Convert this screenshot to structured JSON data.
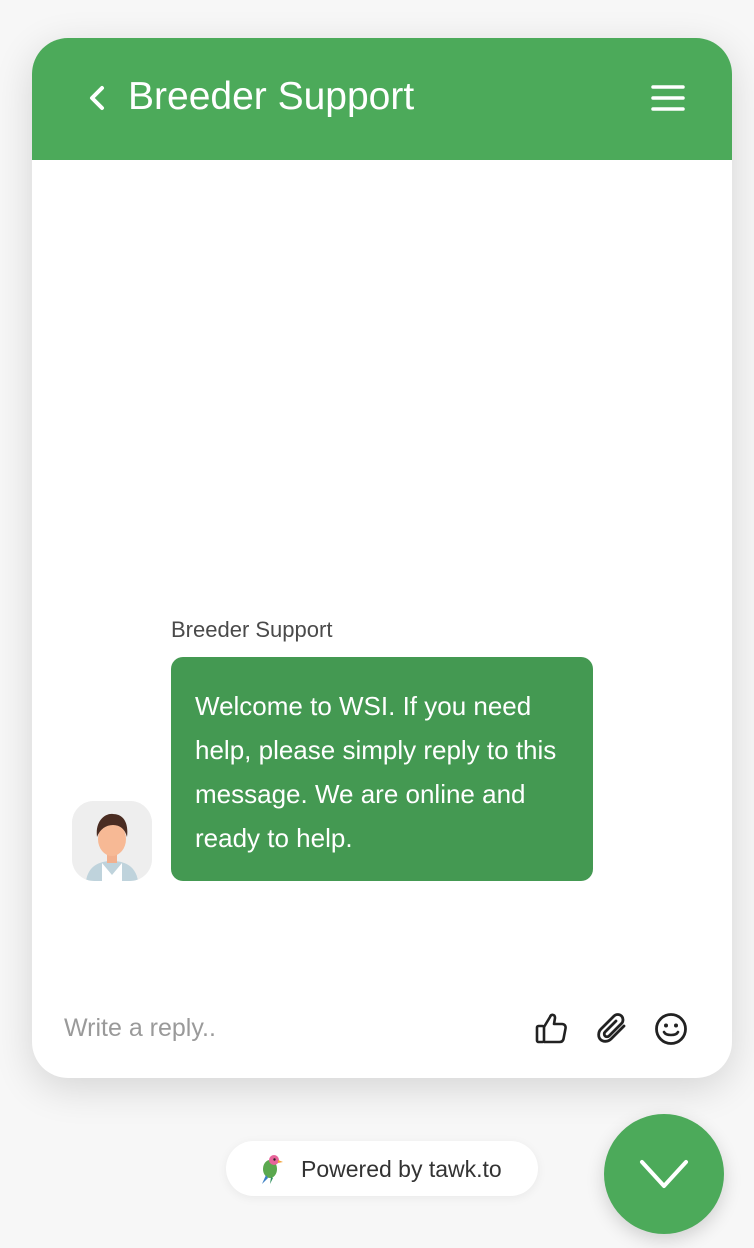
{
  "header": {
    "title": "Breeder Support"
  },
  "message": {
    "sender": "Breeder Support",
    "text": "Welcome to WSI. If you need help, please simply reply to this message. We are online and ready to help."
  },
  "composer": {
    "placeholder": "Write a reply.."
  },
  "footer": {
    "powered_by": "Powered by tawk.to"
  },
  "colors": {
    "header": "#4caa5a",
    "bubble": "#449952",
    "toggle": "#4caa5a"
  },
  "icons": {
    "back": "chevron-left-icon",
    "menu": "hamburger-menu-icon",
    "rate": "thumbs-up-icon",
    "attach": "paperclip-icon",
    "emoji": "smiley-icon",
    "brand": "tawk-parrot-icon",
    "toggle": "chevron-down-icon"
  }
}
